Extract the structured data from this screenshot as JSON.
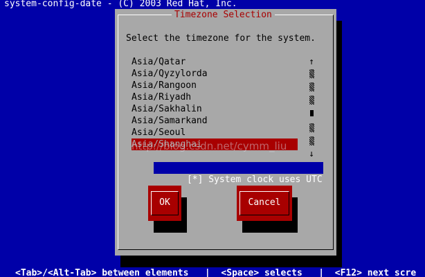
{
  "root_title": "system-config-date - (C) 2003 Red Hat, Inc.",
  "dialog": {
    "title": "Timezone Selection",
    "prompt": "Select the timezone for the system."
  },
  "timezones": [
    {
      "label": "Asia/Qatar",
      "selected": false
    },
    {
      "label": "Asia/Qyzylorda",
      "selected": false
    },
    {
      "label": "Asia/Rangoon",
      "selected": false
    },
    {
      "label": "Asia/Riyadh",
      "selected": false
    },
    {
      "label": "Asia/Sakhalin",
      "selected": false
    },
    {
      "label": "Asia/Samarkand",
      "selected": false
    },
    {
      "label": "Asia/Seoul",
      "selected": false
    },
    {
      "label": "Asia/Shanghai",
      "selected": true
    }
  ],
  "scrollbar": {
    "up_arrow": "↑",
    "down_arrow": "↓"
  },
  "utc_checkbox": {
    "mark": "[*]",
    "label": "System clock uses UTC",
    "checked": true
  },
  "buttons": {
    "ok": "OK",
    "cancel": "Cancel"
  },
  "help_bar": "<Tab>/<Alt-Tab> between elements   |  <Space> selects   |  <F12> next scre",
  "watermark": "http://blog.csdn.net/cymm_liu",
  "colors": {
    "background": "#0000a8",
    "dialog": "#a8a8a8",
    "accent": "#a80000",
    "text": "#000000",
    "highlight_text": "#ffffff"
  }
}
